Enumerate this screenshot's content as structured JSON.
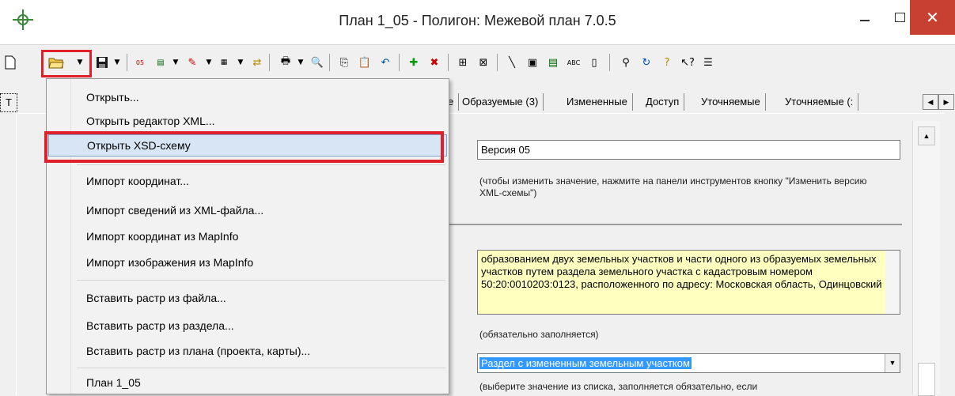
{
  "window": {
    "title": "План 1_05 - Полигон: Межевой план 7.0.5",
    "close_glyph": "✕"
  },
  "toolbar": {
    "icons": [
      "new-document-icon",
      "open-folder-icon",
      "save-icon",
      "xml-export-icon",
      "xml-import-icon",
      "edit-certificate-icon",
      "zip-icon",
      "swap-icon",
      "print-icon",
      "print-preview-icon",
      "copy-icon",
      "paste-icon",
      "undo-icon",
      "add-points-icon",
      "delete-points-icon",
      "table-icon",
      "table-edit-icon",
      "line-tool-icon",
      "scan-icon",
      "xml-schema-icon",
      "spellcheck-icon",
      "page-icon",
      "search-icon",
      "refresh-icon",
      "help-icon",
      "context-help-icon",
      "options-icon"
    ]
  },
  "tabs": [
    {
      "label": "Т"
    },
    {
      "label": "е"
    },
    {
      "label": "Образуемые (3)"
    },
    {
      "label": "Измененные"
    },
    {
      "label": "Доступ"
    },
    {
      "label": "Уточняемые"
    },
    {
      "label": "Уточняемые (:"
    }
  ],
  "form": {
    "version_value": "Версия 05",
    "version_hint": "(чтобы изменить значение, нажмите на панели инструментов кнопку \"Изменить версию XML-схемы\")",
    "purpose_text": "образованием двух земельных участков и части одного из образуемых земельных участков путем раздела земельного участка с кадастровым номером 50:20:0010203:0123, расположенного по адресу: Московская область, Одинцовский",
    "purpose_hint": "(обязательно заполняется)",
    "section_value": "Раздел с измененным земельным участком",
    "section_hint": "(выберите значение из списка, заполняется обязательно, если"
  },
  "menu": {
    "items": [
      {
        "label": "Открыть..."
      },
      {
        "label": "Открыть редактор XML..."
      },
      {
        "label": "Открыть XSD-схему"
      },
      {
        "label": "Импорт координат..."
      },
      {
        "label": "Импорт сведений из XML-файла..."
      },
      {
        "label": "Импорт координат из MapInfo"
      },
      {
        "label": "Импорт изображения из MapInfo"
      },
      {
        "label": "Вставить растр из файла..."
      },
      {
        "label": "Вставить растр из раздела..."
      },
      {
        "label": "Вставить растр из плана (проекта, карты)..."
      },
      {
        "label": "План 1_05"
      }
    ]
  },
  "colors": {
    "highlight": "#e0202a",
    "menu_active": "#d7e5f4",
    "selection": "#3399ff",
    "note_bg": "#ffffc0"
  }
}
